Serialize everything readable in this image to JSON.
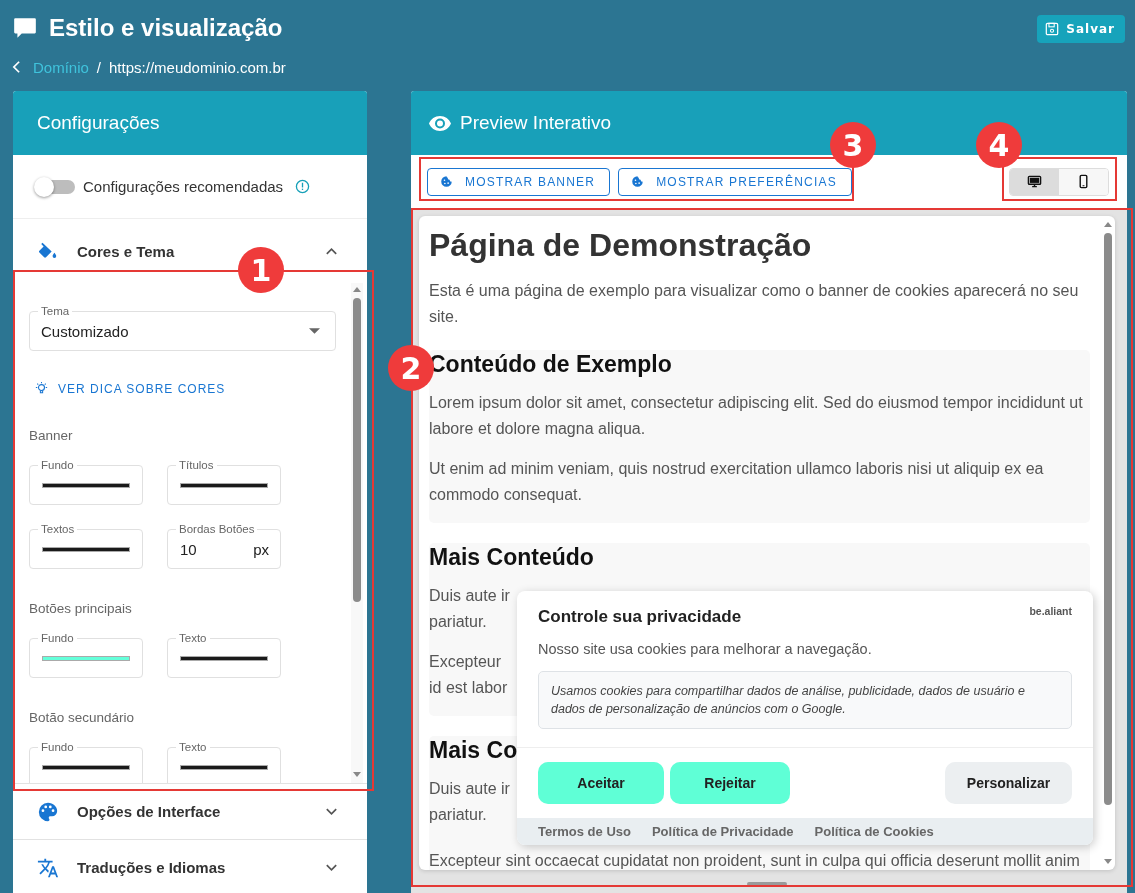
{
  "header": {
    "title": "Estilo e visualização",
    "save_button": "Salvar"
  },
  "breadcrumb": {
    "link": "Domínio",
    "separator": "/",
    "current": "https://meudominio.com.br"
  },
  "settings_panel": {
    "title": "Configurações",
    "recommended_toggle": {
      "label": "Configurações recomendadas",
      "on": false
    },
    "sections": [
      {
        "title": "Cores e Tema",
        "kind": "colors",
        "expanded": true,
        "theme_select": {
          "label": "Tema",
          "value": "Customizado"
        },
        "tip_link": "VER DICA SOBRE CORES",
        "groups": [
          {
            "title": "Banner",
            "fields": [
              {
                "label": "Fundo",
                "kind": "color",
                "color": "#1a1a1a"
              },
              {
                "label": "Títulos",
                "kind": "color",
                "color": "#1a1a1a"
              },
              {
                "label": "Textos",
                "kind": "color",
                "color": "#1a1a1a"
              },
              {
                "label": "Bordas Botões",
                "kind": "number",
                "value": "10",
                "unit": "px"
              }
            ]
          },
          {
            "title": "Botões principais",
            "fields": [
              {
                "label": "Fundo",
                "kind": "color",
                "color": "#64ffda"
              },
              {
                "label": "Texto",
                "kind": "color",
                "color": "#1a1a1a"
              }
            ]
          },
          {
            "title": "Botão secundário",
            "fields": [
              {
                "label": "Fundo",
                "kind": "color",
                "color": "#1a1a1a"
              },
              {
                "label": "Texto",
                "kind": "color",
                "color": "#1a1a1a"
              }
            ]
          }
        ]
      },
      {
        "title": "Opções de Interface",
        "kind": "interface",
        "expanded": false
      },
      {
        "title": "Traduções e Idiomas",
        "kind": "translations",
        "expanded": false
      }
    ]
  },
  "preview": {
    "title": "Preview Interativo",
    "actions": [
      "MOSTRAR BANNER",
      "MOSTRAR PREFERÊNCIAS"
    ],
    "devices": [
      {
        "kind": "desktop",
        "selected": true
      },
      {
        "kind": "mobile",
        "selected": false
      }
    ],
    "page": {
      "heading": "Página de Demonstração",
      "intro": "Esta é uma página de exemplo para visualizar como o banner de cookies aparecerá no seu site.",
      "sections": [
        {
          "heading": "Conteúdo de Exemplo",
          "paragraphs": [
            "Lorem ipsum dolor sit amet, consectetur adipiscing elit. Sed do eiusmod tempor incididunt ut labore et dolore magna aliqua.",
            "Ut enim ad minim veniam, quis nostrud exercitation ullamco laboris nisi ut aliquip ex ea commodo consequat."
          ]
        },
        {
          "heading": "Mais Conteúdo",
          "paragraphs": [
            "Duis aute ir\npariatur.",
            "Excepteur\nid est labor"
          ]
        },
        {
          "heading": "Mais Co",
          "paragraphs": [
            "Duis aute ir\npariatur.",
            "Excepteur sint occaecat cupidatat non proident, sunt in culpa qui officia deserunt mollit anim"
          ]
        }
      ]
    },
    "banner": {
      "title": "Controle sua privacidade",
      "brand": "be.aliant",
      "text": "Nosso site usa cookies para melhorar a navegação.",
      "notice": "Usamos cookies para compartilhar dados de análise, publicidade, dados de usuário e dados de personalização de anúncios com o Google.",
      "buttons": [
        {
          "label": "Aceitar",
          "kind": "primary"
        },
        {
          "label": "Rejeitar",
          "kind": "primary"
        },
        {
          "label": "Personalizar",
          "kind": "secondary"
        }
      ],
      "links": [
        "Termos de Uso",
        "Política de Privacidade",
        "Política de Cookies"
      ]
    }
  },
  "annotations": [
    {
      "number": "1"
    },
    {
      "number": "2"
    },
    {
      "number": "3"
    },
    {
      "number": "4"
    }
  ]
}
